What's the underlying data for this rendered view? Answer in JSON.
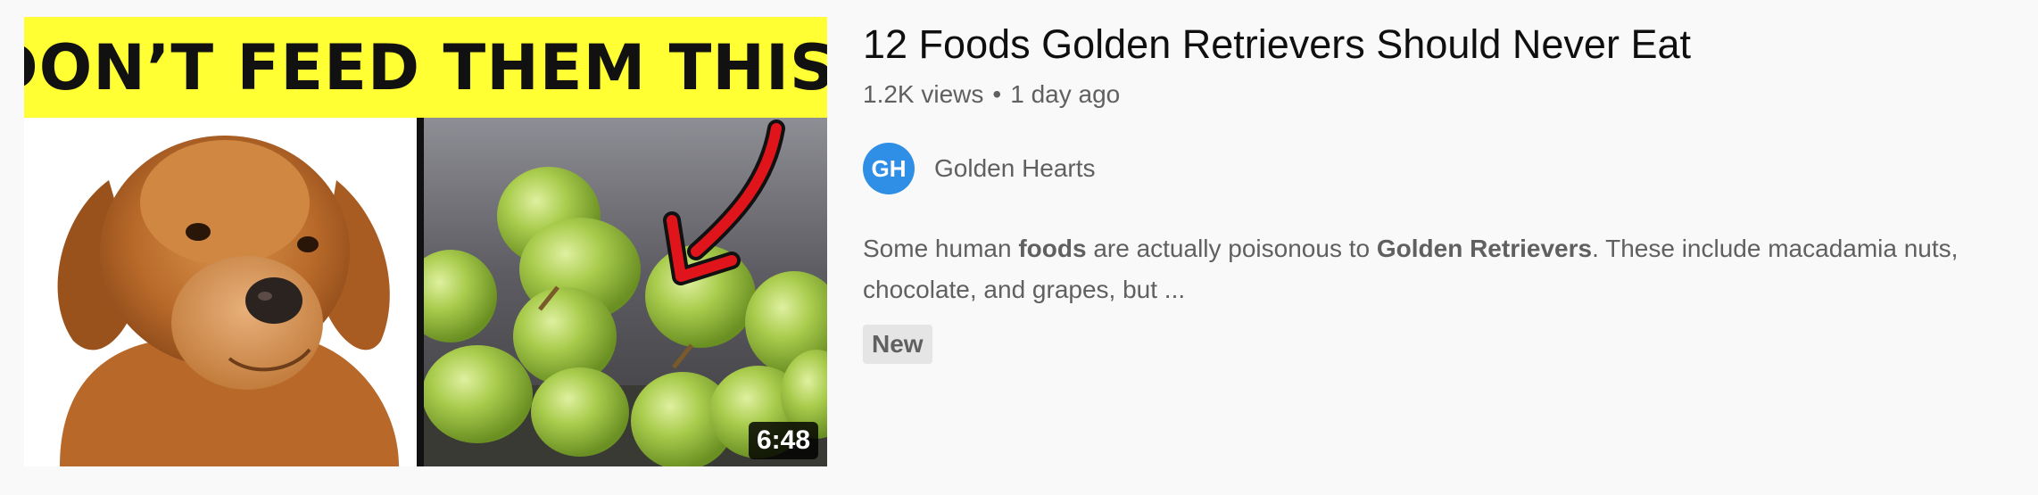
{
  "video": {
    "thumbnail": {
      "banner_text": "DON’T FEED THEM THIS!",
      "duration": "6:48",
      "banner_color": "#ffff33"
    },
    "title": "12 Foods Golden Retrievers Should Never Eat",
    "views": "1.2K views",
    "separator": "•",
    "age": "1 day ago",
    "channel": {
      "avatar_initials": "GH",
      "avatar_color": "#2f8fe6",
      "name": "Golden Hearts"
    },
    "description": {
      "part1": "Some human ",
      "bold1": "foods",
      "part2": " are actually poisonous to ",
      "bold2": "Golden Retrievers",
      "part3": ". These include macadamia nuts,",
      "line2": "chocolate, and grapes, but ..."
    },
    "badge": "New"
  }
}
